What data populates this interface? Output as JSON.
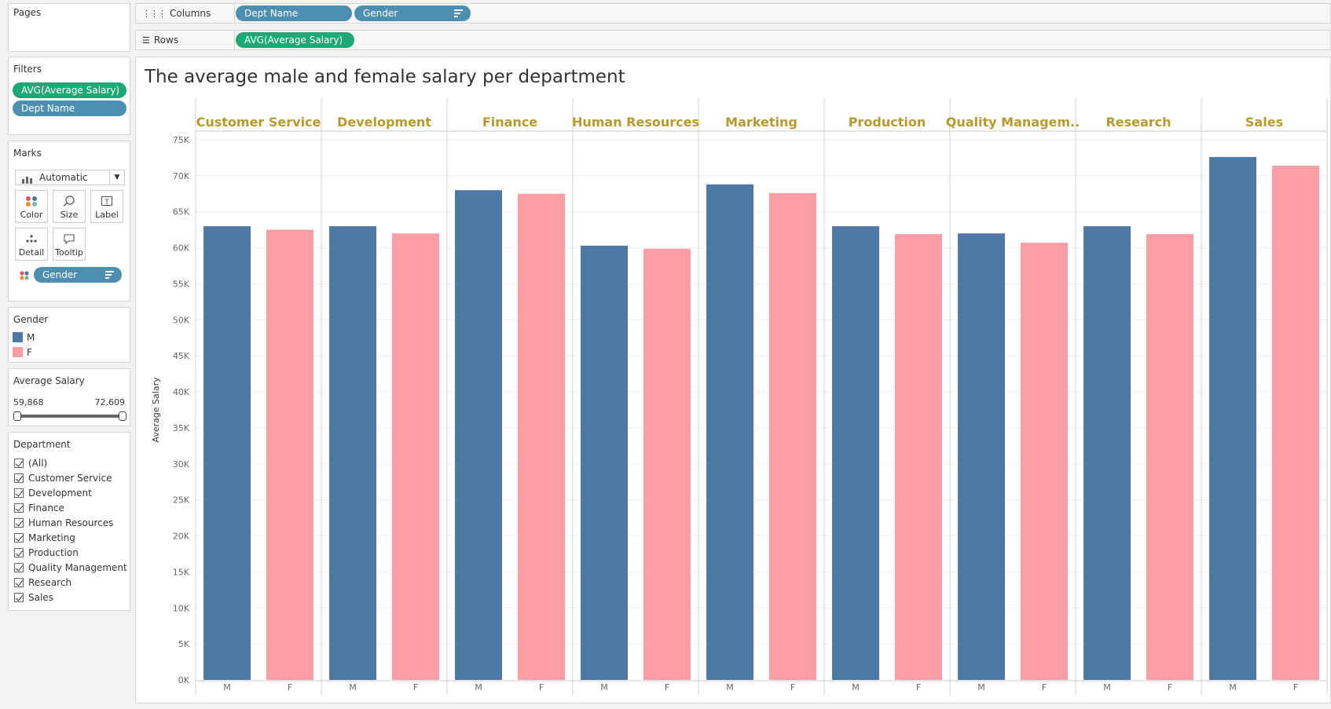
{
  "shelves": {
    "pages_label": "Pages",
    "columns_label": "Columns",
    "rows_label": "Rows",
    "columns_pills": [
      "Dept Name",
      "Gender"
    ],
    "rows_pills": [
      "AVG(Average Salary)"
    ]
  },
  "filters": {
    "title": "Filters",
    "items": [
      "AVG(Average Salary)",
      "Dept Name"
    ]
  },
  "marks": {
    "title": "Marks",
    "type": "Automatic",
    "buttons": [
      "Color",
      "Size",
      "Label",
      "Detail",
      "Tooltip"
    ],
    "pill": "Gender"
  },
  "gender_legend": {
    "title": "Gender",
    "items": [
      {
        "label": "M",
        "color": "#4e79a7"
      },
      {
        "label": "F",
        "color": "#ff9da7"
      }
    ]
  },
  "salary_filter": {
    "title": "Average Salary",
    "min": "59,868",
    "max": "72,609"
  },
  "department_filter": {
    "title": "Department",
    "items": [
      "(All)",
      "Customer Service",
      "Development",
      "Finance",
      "Human Resources",
      "Marketing",
      "Production",
      "Quality Management",
      "Research",
      "Sales"
    ]
  },
  "chart_data": {
    "type": "bar",
    "title": "The average male and female salary per department",
    "ylabel": "Average Salary",
    "ylim": [
      0,
      75000
    ],
    "yticks": [
      "0K",
      "5K",
      "10K",
      "15K",
      "20K",
      "25K",
      "30K",
      "35K",
      "40K",
      "45K",
      "50K",
      "55K",
      "60K",
      "65K",
      "70K",
      "75K"
    ],
    "header_color": "#b69a2d",
    "categories": [
      "Customer Service",
      "Development",
      "Finance",
      "Human Resources",
      "Marketing",
      "Production",
      "Quality Managem..",
      "Research",
      "Sales"
    ],
    "series": [
      {
        "name": "M",
        "color": "#4e79a7",
        "values": [
          63000,
          63000,
          68000,
          60300,
          68800,
          63000,
          62000,
          63000,
          72609
        ]
      },
      {
        "name": "F",
        "color": "#ff9da7",
        "values": [
          62500,
          62000,
          67500,
          59868,
          67600,
          61900,
          60700,
          61900,
          71400
        ]
      }
    ]
  }
}
